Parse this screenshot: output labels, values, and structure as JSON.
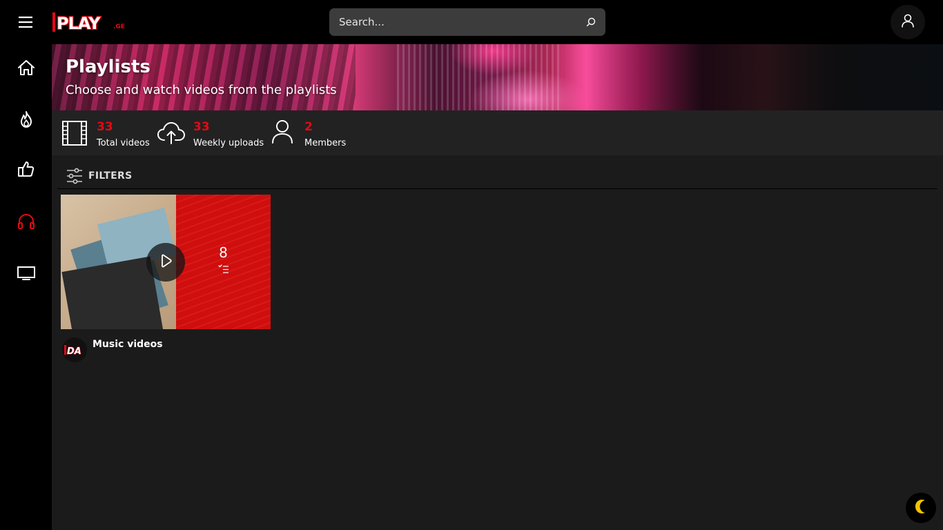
{
  "header": {
    "logo_text": "PLAY",
    "logo_suffix": ".GE",
    "search_placeholder": "Search..."
  },
  "sidebar": {
    "items": [
      {
        "icon": "home-icon",
        "active": false
      },
      {
        "icon": "fire-icon",
        "active": false
      },
      {
        "icon": "thumbs-up-icon",
        "active": false
      },
      {
        "icon": "headphones-icon",
        "active": true
      },
      {
        "icon": "tv-icon",
        "active": false
      }
    ]
  },
  "banner": {
    "title": "Playlists",
    "subtitle": "Choose and watch videos from the playlists"
  },
  "stats": [
    {
      "icon": "film-icon",
      "value": "33",
      "label": "Total videos"
    },
    {
      "icon": "cloud-upload-icon",
      "value": "33",
      "label": "Weekly uploads"
    },
    {
      "icon": "user-icon",
      "value": "2",
      "label": "Members"
    }
  ],
  "filters": {
    "label": "FILTERS"
  },
  "playlists": [
    {
      "title": "Music videos",
      "video_count": "8",
      "channel_avatar_text": "DA"
    }
  ],
  "colors": {
    "accent": "#e50914",
    "background": "#1b1b1b",
    "sidebar": "#000000",
    "search_bg": "#3c3c3c",
    "moon": "#f5c400"
  }
}
